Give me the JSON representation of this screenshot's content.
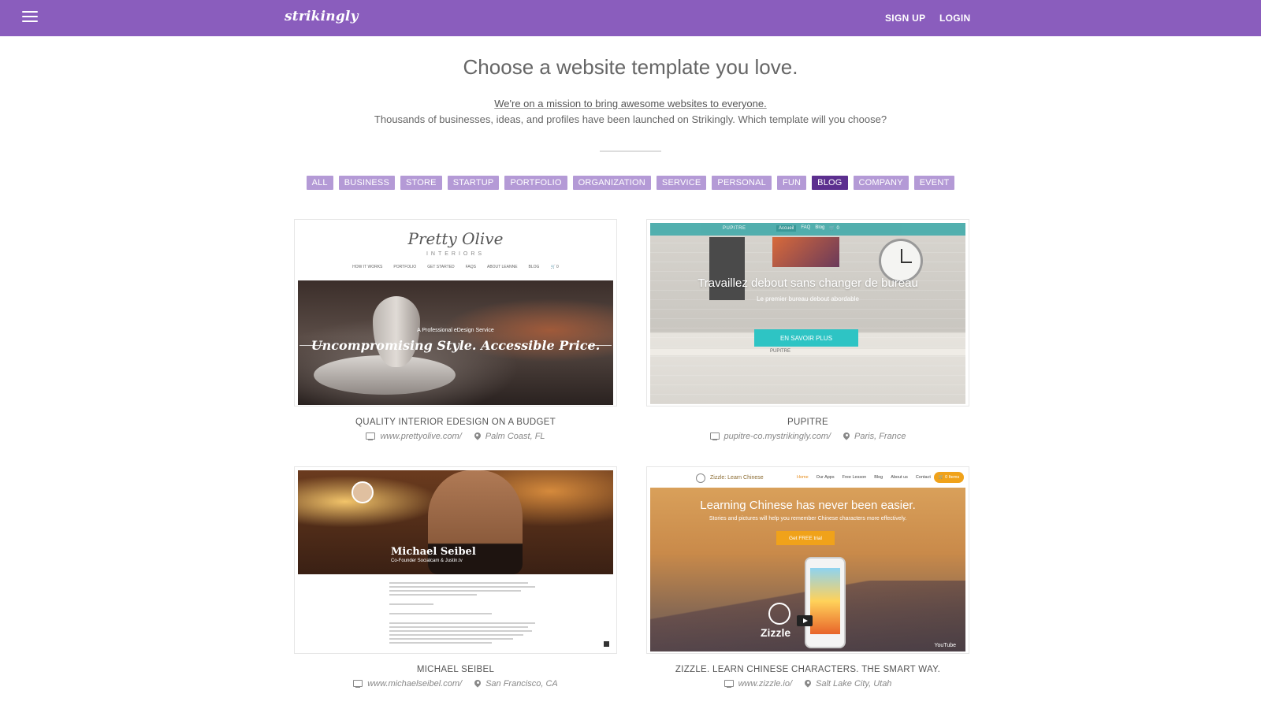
{
  "header": {
    "logo": "strikingly",
    "menu_icon": "hamburger-menu-icon",
    "sign_up": "SIGN UP",
    "login": "LOGIN",
    "color": "#8a5dbd"
  },
  "hero": {
    "headline": "Choose a website template you love.",
    "mission_link": "We're on a mission to bring awesome websites to everyone.",
    "subline": "Thousands of businesses, ideas, and profiles have been launched on Strikingly. Which template will you choose?"
  },
  "filters": {
    "items": [
      "ALL",
      "BUSINESS",
      "STORE",
      "STARTUP",
      "PORTFOLIO",
      "ORGANIZATION",
      "SERVICE",
      "PERSONAL",
      "FUN",
      "BLOG",
      "COMPANY",
      "EVENT"
    ],
    "active": "BLOG",
    "active_color": "#5c2f8f",
    "inactive_color": "#b49ad6"
  },
  "templates": [
    {
      "title": "QUALITY INTERIOR EDESIGN ON A BUDGET",
      "url": "www.prettyolive.com/",
      "location": "Palm Coast, FL",
      "preview": {
        "brand": "Pretty Olive",
        "brand_sub": "INTERIORS",
        "nav": [
          "HOW IT WORKS",
          "PORTFOLIO",
          "GET STARTED",
          "FAQS",
          "ABOUT LEANNE",
          "BLOG",
          "🛒 0"
        ],
        "kicker": "A Professional eDesign Service",
        "tagline": "Uncompromising Style. Accessible Price."
      }
    },
    {
      "title": "PUPITRE",
      "url": "pupitre-co.mystrikingly.com/",
      "location": "Paris, France",
      "preview": {
        "brand": "PUPITRE",
        "nav": [
          "Accueil",
          "FAQ",
          "Blog",
          "🛒 0"
        ],
        "headline": "Travaillez debout sans changer de bureau",
        "sub": "Le premier bureau debout abordable",
        "cta": "EN SAVOIR PLUS",
        "small": "PUPITRE"
      }
    },
    {
      "title": "MICHAEL SEIBEL",
      "url": "www.michaelseibel.com/",
      "location": "San Francisco, CA",
      "preview": {
        "name": "Michael Seibel",
        "role": "Co-Founder Socialcam & Justin.tv"
      }
    },
    {
      "title": "ZIZZLE. LEARN CHINESE CHARACTERS. THE SMART WAY.",
      "url": "www.zizzle.io/",
      "location": "Salt Lake City, Utah",
      "preview": {
        "brand": "Zizzle: Learn Chinese",
        "nav": [
          "Home",
          "Our Apps",
          "Free Lesson",
          "Blog",
          "About us",
          "Contact"
        ],
        "pill": "🛒 0 Items",
        "headline": "Learning Chinese has never been easier.",
        "sub": "Stories and pictures will help you remember Chinese characters more effectively.",
        "cta": "Get FREE trial",
        "mark": "Zizzle",
        "video_brand": "YouTube"
      }
    }
  ]
}
